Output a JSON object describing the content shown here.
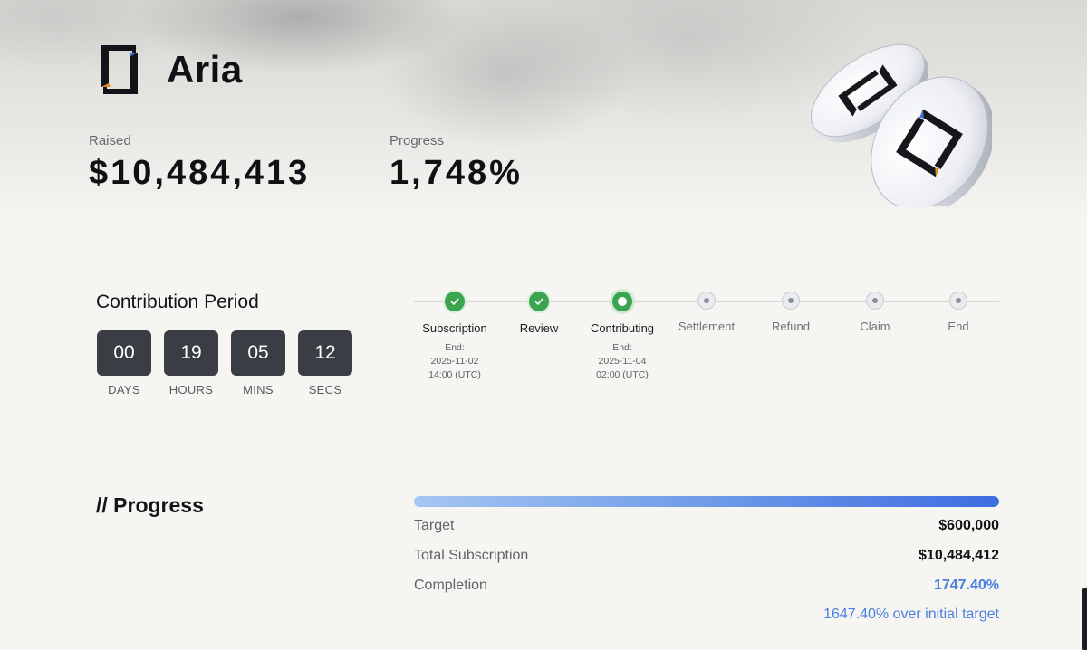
{
  "project": {
    "name": "Aria",
    "logo": "aria-logo-icon"
  },
  "stats": {
    "raised_label": "Raised",
    "raised_value": "$10,484,413",
    "progress_label": "Progress",
    "progress_value": "1,748%"
  },
  "contribution": {
    "title": "Contribution Period",
    "countdown": [
      {
        "value": "00",
        "label": "DAYS"
      },
      {
        "value": "19",
        "label": "HOURS"
      },
      {
        "value": "05",
        "label": "MINS"
      },
      {
        "value": "12",
        "label": "SECS"
      }
    ]
  },
  "stages": [
    {
      "name": "Subscription",
      "status": "done",
      "end_label": "End:",
      "date": "2025-11-02",
      "time": "14:00 (UTC)"
    },
    {
      "name": "Review",
      "status": "done"
    },
    {
      "name": "Contributing",
      "status": "active",
      "end_label": "End:",
      "date": "2025-11-04",
      "time": "02:00 (UTC)"
    },
    {
      "name": "Settlement",
      "status": "pending"
    },
    {
      "name": "Refund",
      "status": "pending"
    },
    {
      "name": "Claim",
      "status": "pending"
    },
    {
      "name": "End",
      "status": "pending"
    }
  ],
  "progress_section": {
    "title": "// Progress",
    "bar_fill_fraction": 1.0,
    "target_label": "Target",
    "target_value": "$600,000",
    "subscription_label": "Total Subscription",
    "subscription_value": "$10,484,412",
    "completion_label": "Completion",
    "completion_value": "1747.40%",
    "over_target_note": "1647.40% over initial target"
  },
  "colors": {
    "accent_blue": "#4a7fe0",
    "step_done_green": "#3aa44f",
    "countdown_box": "#3a3d44",
    "background": "#f6f5f2"
  }
}
